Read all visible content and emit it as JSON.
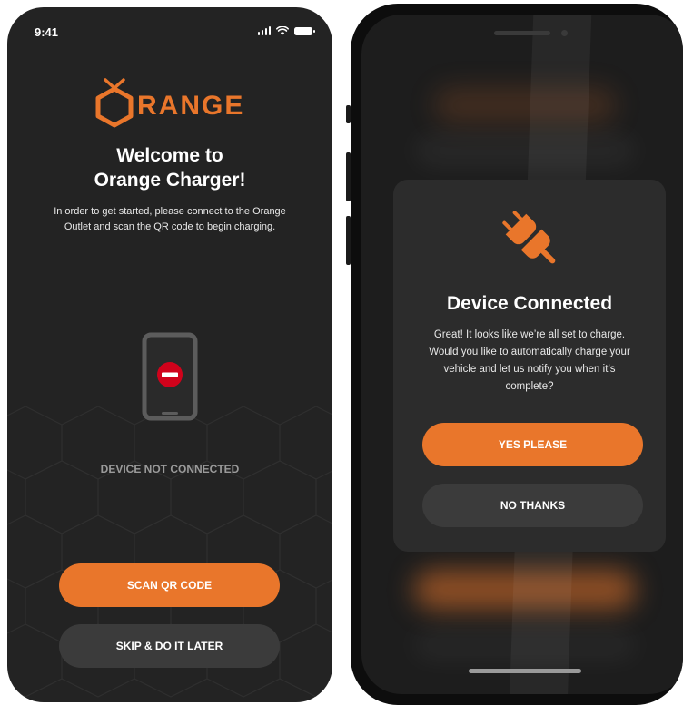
{
  "left_screen": {
    "status": {
      "time": "9:41"
    },
    "logo_text": "RANGE",
    "welcome": {
      "line1": "Welcome to",
      "line2": "Orange Charger!",
      "desc_line1": "In order to get started, please connect to the Orange",
      "desc_line2": "Outlet and scan the QR code to begin charging."
    },
    "device_status": "DEVICE NOT CONNECTED",
    "buttons": {
      "scan": "SCAN QR CODE",
      "skip": "SKIP & DO IT LATER"
    }
  },
  "right_screen": {
    "modal": {
      "title": "Device Connected",
      "desc_line1": "Great! It looks like we’re all set to charge.",
      "desc_line2": "Would you like to automatically charge your",
      "desc_line3": "vehicle and let us notify you when it’s",
      "desc_line4": "complete?",
      "yes_label": "YES PLEASE",
      "no_label": "NO THANKS"
    }
  },
  "colors": {
    "accent": "#e9762b",
    "dark_bg": "#232323",
    "modal_bg": "#2c2c2c",
    "secondary_button": "#3b3b3b",
    "error_red": "#d0021b"
  },
  "icons": {
    "logo": "hexagon-o-logo-icon",
    "device": "phone-disconnected-icon",
    "plug": "plug-connected-icon"
  }
}
